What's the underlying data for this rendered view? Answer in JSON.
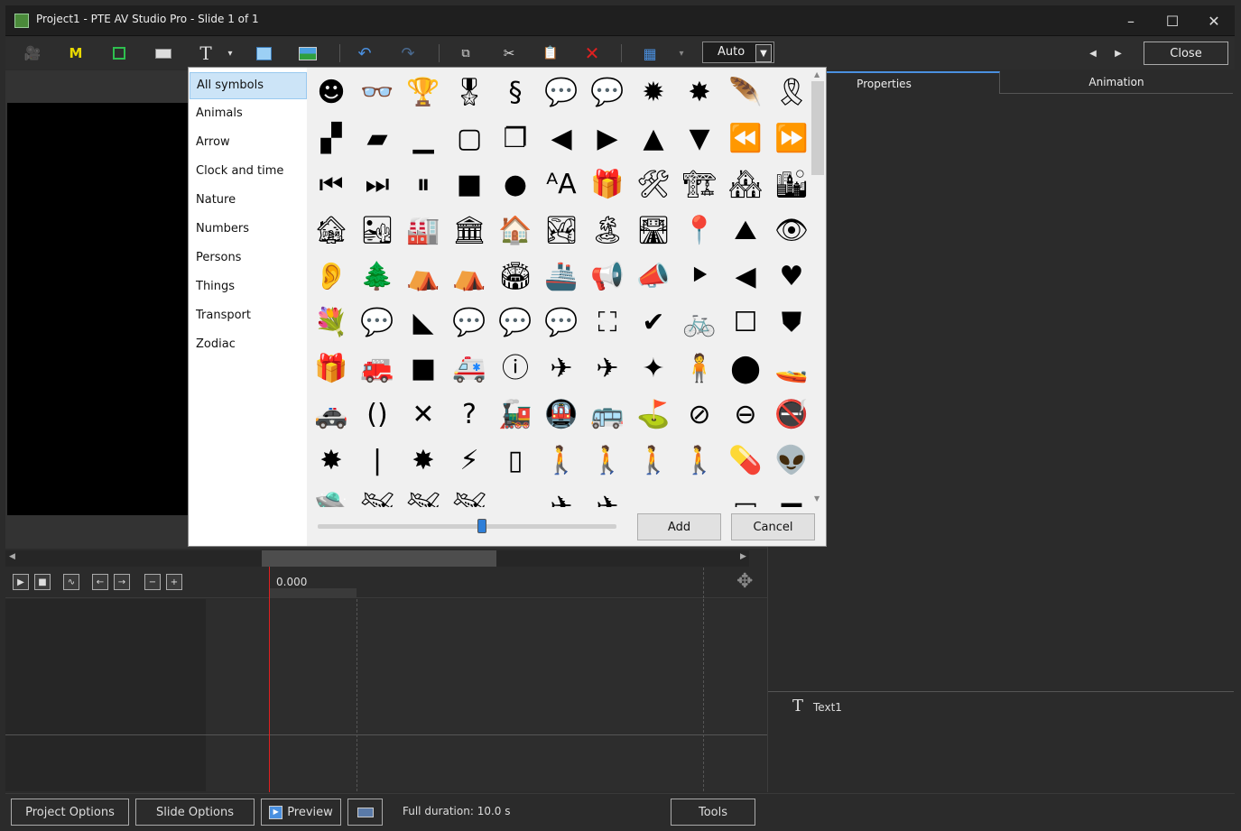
{
  "window": {
    "title": "Project1 - PTE AV Studio Pro - Slide 1 of 1",
    "controls": [
      "–",
      "☐",
      "✕"
    ]
  },
  "toolbar": {
    "zoom_value": "Auto",
    "close_label": "Close",
    "icons": [
      "camera-icon",
      "mask-icon",
      "frame-icon",
      "button-icon",
      "text-icon",
      "dropdown-icon",
      "rectangle-icon",
      "image-icon",
      "undo-icon",
      "redo-icon",
      "copy-icon",
      "cut-icon",
      "paste-icon",
      "delete-icon",
      "grid-icon",
      "grid-dropdown-icon"
    ]
  },
  "dialog": {
    "categories": [
      "All symbols",
      "Animals",
      "Arrow",
      "Clock and time",
      "Nature",
      "Numbers",
      "Persons",
      "Things",
      "Transport",
      "Zodiac"
    ],
    "selected_category": "All symbols",
    "zoom_level": 0.55,
    "add_label": "Add",
    "cancel_label": "Cancel"
  },
  "symbols": [
    [
      "☻",
      "👓",
      "🏆",
      "🎖",
      "§",
      "💬",
      "💬",
      "✹",
      "✸",
      "🪶",
      "🎗"
    ],
    [
      "▞",
      "▰",
      "▁",
      "▢",
      "❐",
      "◀",
      "▶",
      "▲",
      "▼",
      "⏪",
      "⏩"
    ],
    [
      "⏮",
      "⏭",
      "⏸",
      "■",
      "●",
      "ᴬA",
      "🎁",
      "🛠",
      "🏗",
      "🏘",
      "🏙"
    ],
    [
      "🏚",
      "🏜",
      "🏭",
      "🏛",
      "🏠",
      "🏞",
      "🏝",
      "🛣",
      "📍",
      "⛰",
      "👁"
    ],
    [
      "👂",
      "🌲",
      "⛺",
      "⛺",
      "🏟",
      "🚢",
      "📢",
      "📣",
      "⯈",
      "◀",
      "♥"
    ],
    [
      "💐",
      "💬",
      "◣",
      "💬",
      "💬",
      "💬",
      "⛶",
      "✔",
      "🚲",
      "☐",
      "⛊"
    ],
    [
      "🎁",
      "🚒",
      "■",
      "🚑",
      "ⓘ",
      "✈",
      "✈",
      "✦",
      "🧍",
      "⬤",
      "🚤"
    ],
    [
      "🚓",
      "()",
      "✕",
      "?",
      "🚂",
      "🚇",
      "🚌",
      "⛳",
      "⊘",
      "⊖",
      "🚭"
    ],
    [
      "✸",
      "|",
      "✸",
      "⚡",
      "▯",
      "🚶",
      "🚶",
      "🚶",
      "🚶",
      "💊",
      "👽"
    ],
    [
      "🛸",
      "🛩",
      "🛩",
      "🛩",
      "",
      "✈",
      "✈",
      "",
      "",
      "▭",
      "▬"
    ]
  ],
  "timeline": {
    "time_readout": "0.000",
    "buttons": [
      "▶",
      "■",
      "∿",
      "←",
      "→",
      "−",
      "+"
    ]
  },
  "right_panel": {
    "tabs": [
      "Properties",
      "Animation"
    ],
    "object_icon": "T",
    "object_name": "Text1"
  },
  "statusbar": {
    "project_options": "Project Options",
    "slide_options": "Slide Options",
    "preview": "Preview",
    "full_duration": "Full duration: 10.0 s",
    "tools": "Tools"
  }
}
